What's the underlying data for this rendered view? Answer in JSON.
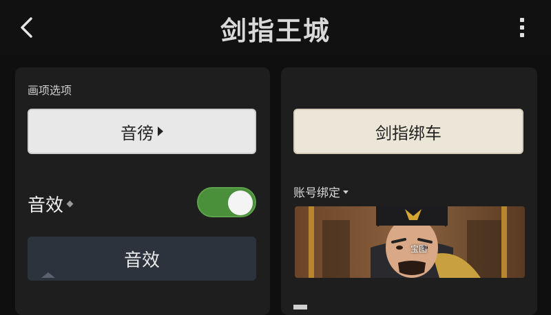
{
  "header": {
    "title": "剑指王城",
    "back_icon": "chevron-left-icon",
    "more_icon": "more-vertical-icon"
  },
  "left_panel": {
    "section_label": "画项选项",
    "sound_button_label": "音徬",
    "sfx_label": "音效",
    "sfx_toggle_on": true,
    "sfx_button_label": "音效"
  },
  "right_panel": {
    "bind_button_label": "剑指绑车",
    "account_label": "账号绑定",
    "avatar_badge": "宝图"
  },
  "colors": {
    "background": "#0f0f0f",
    "panel": "#1e1e1e",
    "toggle_on": "#4a8f3a",
    "sfx_button": "#2c333d"
  }
}
